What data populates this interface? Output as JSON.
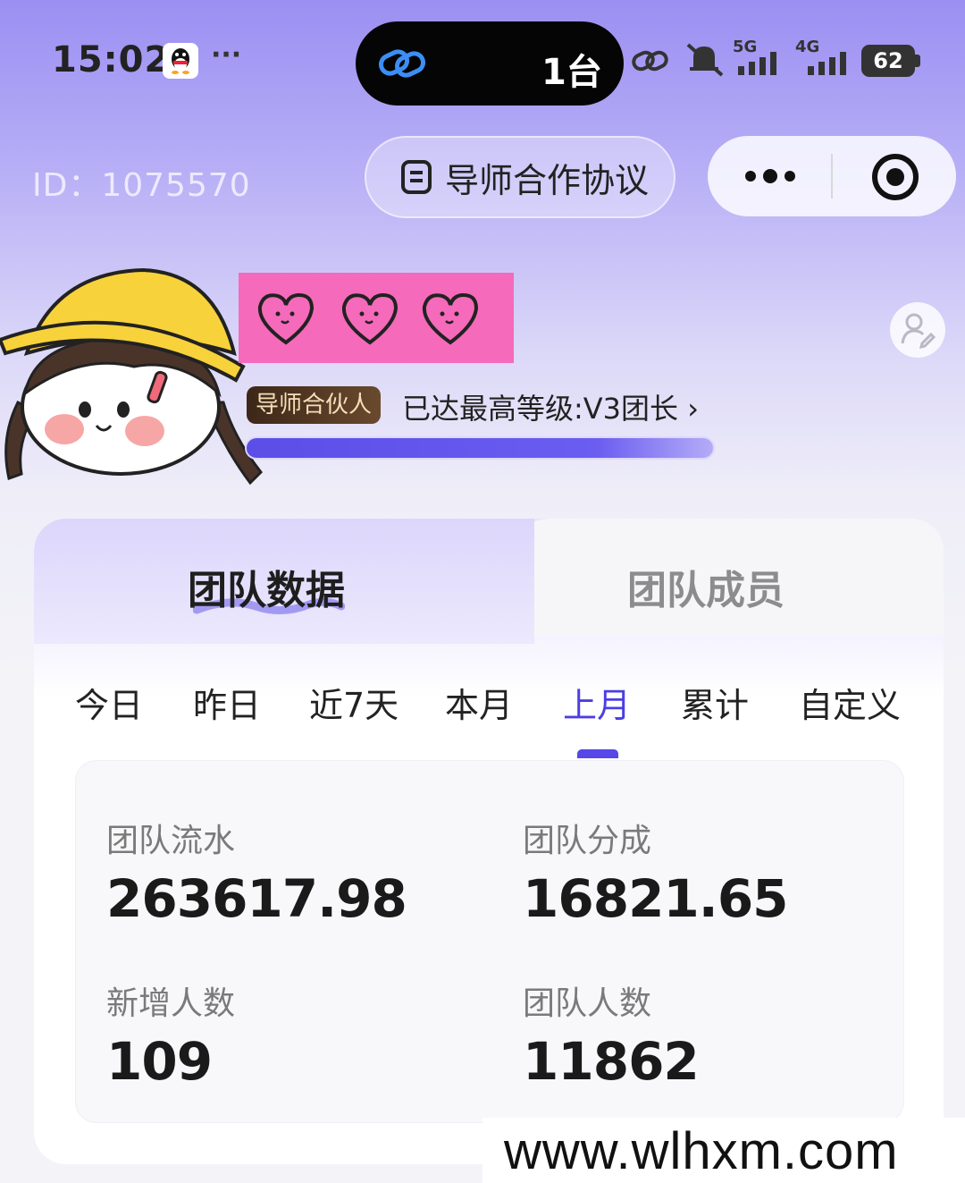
{
  "status_bar": {
    "time": "15:02",
    "more": "···",
    "island_devices": "1台",
    "network_5g": "5G",
    "network_4g": "4G",
    "battery": "62"
  },
  "header": {
    "user_id": "ID：1075570",
    "agreement_button": "导师合作协议"
  },
  "profile": {
    "role_badge": "导师合伙人",
    "level_text": "已达最高等级:V3团长 ›",
    "level_progress": 1.0
  },
  "tabs": [
    {
      "label": "团队数据",
      "active": true
    },
    {
      "label": "团队成员",
      "active": false
    }
  ],
  "periods": [
    {
      "label": "今日"
    },
    {
      "label": "昨日"
    },
    {
      "label": "近7天"
    },
    {
      "label": "本月"
    },
    {
      "label": "上月",
      "active": true
    },
    {
      "label": "累计"
    },
    {
      "label": "自定义"
    }
  ],
  "stats": {
    "team_flow_label": "团队流水",
    "team_flow_value": "263617.98",
    "team_share_label": "团队分成",
    "team_share_value": "16821.65",
    "new_members_label": "新增人数",
    "new_members_value": "109",
    "team_size_label": "团队人数",
    "team_size_value": "11862"
  },
  "watermark": "www.wlhxm.com",
  "colors": {
    "accent": "#4b3ee4",
    "badge_bg": "#3c2718",
    "nickname_bg": "#f56aba"
  }
}
